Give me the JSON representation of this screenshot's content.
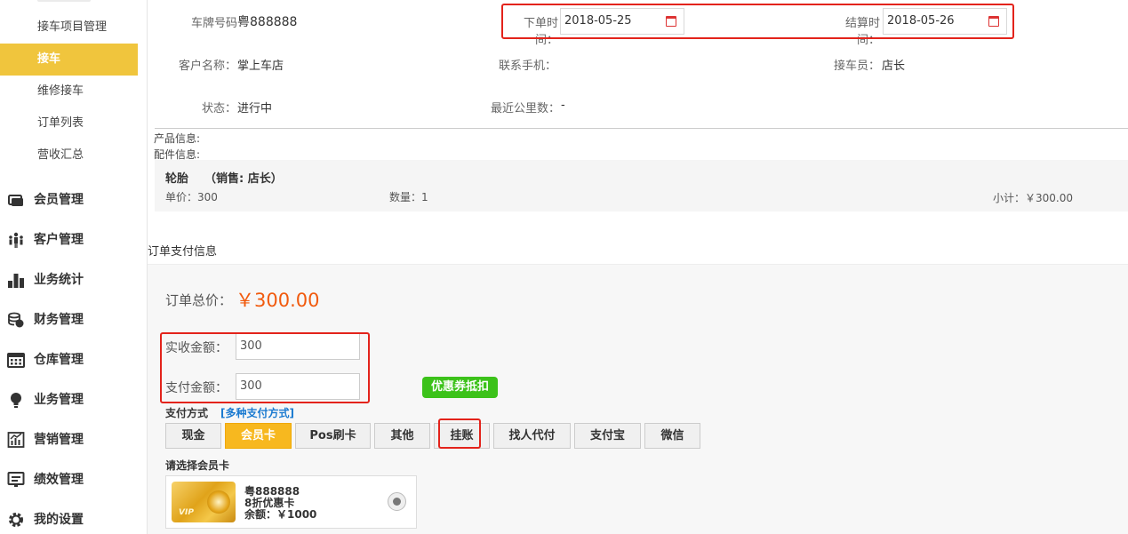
{
  "sidebar": {
    "sub_items": [
      {
        "label": "接车项目管理",
        "active": false
      },
      {
        "label": "接车",
        "active": true
      },
      {
        "label": "维修接车",
        "active": false
      },
      {
        "label": "订单列表",
        "active": false
      },
      {
        "label": "营收汇总",
        "active": false
      }
    ],
    "nav_items": [
      {
        "label": "会员管理",
        "icon": "member-card-icon"
      },
      {
        "label": "客户管理",
        "icon": "customers-icon"
      },
      {
        "label": "业务统计",
        "icon": "bar-chart-icon"
      },
      {
        "label": "财务管理",
        "icon": "coins-icon"
      },
      {
        "label": "仓库管理",
        "icon": "warehouse-icon"
      },
      {
        "label": "业务管理",
        "icon": "lightbulb-icon"
      },
      {
        "label": "营销管理",
        "icon": "marketing-chart-icon"
      },
      {
        "label": "绩效管理",
        "icon": "performance-icon"
      },
      {
        "label": "我的设置",
        "icon": "gear-icon"
      }
    ],
    "active_color": "#f0c53d"
  },
  "order": {
    "plate_label": "车牌号码：",
    "plate_value": "粤888888",
    "order_time_label": "下单时间：",
    "order_time_value": "2018-05-25",
    "settle_time_label": "结算时间：",
    "settle_time_value": "2018-05-26",
    "customer_label": "客户名称：",
    "customer_value": "掌上车店",
    "phone_label": "联系手机：",
    "phone_value": "",
    "receiver_label": "接车员：",
    "receiver_value": "店长",
    "status_label": "状态：",
    "status_value": "进行中",
    "mileage_label": "最近公里数：",
    "mileage_value": "-"
  },
  "products": {
    "product_info_label": "产品信息:",
    "parts_info_label": "配件信息:",
    "item_name": "轮胎",
    "item_sales": "（销售: 店长）",
    "unit_price": "单价：300",
    "quantity": "数量：1",
    "subtotal": "小计：￥300.00"
  },
  "payment": {
    "section_title": "订单支付信息",
    "total_label": "订单总价：",
    "total_value": "￥300.00",
    "received_label": "实收金额：",
    "received_value": "300",
    "paid_label": "支付金额：",
    "paid_value": "300",
    "coupon_button": "优惠券抵扣",
    "method_label": "支付方式",
    "multi_method_link": "[多种支付方式]",
    "methods": [
      {
        "label": "现金",
        "active": false
      },
      {
        "label": "会员卡",
        "active": true
      },
      {
        "label": "Pos刷卡",
        "active": false
      },
      {
        "label": "其他",
        "active": false
      },
      {
        "label": "挂账",
        "active": false
      },
      {
        "label": "找人代付",
        "active": false
      },
      {
        "label": "支付宝",
        "active": false
      },
      {
        "label": "微信",
        "active": false
      }
    ],
    "choose_card_label": "请选择会员卡",
    "card": {
      "plate": "粤888888",
      "type": "8折优惠卡",
      "balance": "余额：￥1000"
    },
    "accent_color": "#f15a0d",
    "link_color": "#1a7ad0",
    "highlight_color": "#e3231b"
  }
}
